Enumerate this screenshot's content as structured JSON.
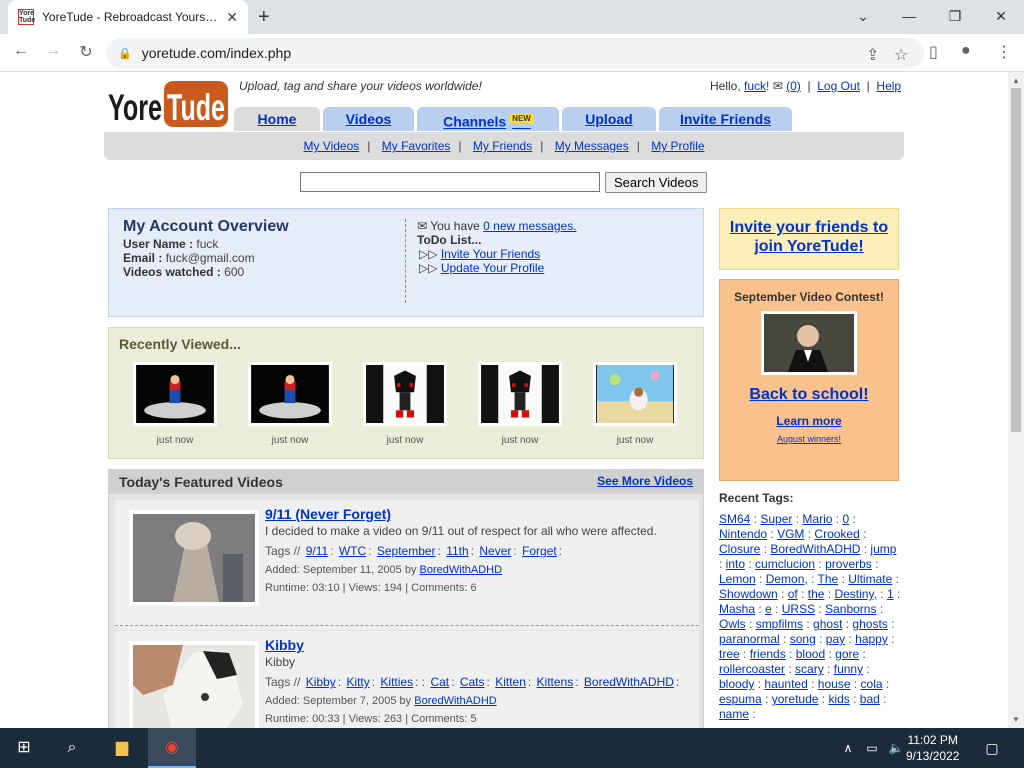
{
  "browser": {
    "tab_title": "YoreTude - Rebroadcast Yourself.",
    "favicon_text": "Yore Tude",
    "url": "yoretude.com/index.php"
  },
  "site": {
    "logo_text_1": "Yore",
    "logo_text_2": "Tude",
    "tagline": "Upload, tag and share your videos worldwide!",
    "hello": "Hello,",
    "username_link": "fuck",
    "messages_count": "(0)",
    "logout": "Log Out",
    "help": "Help"
  },
  "nav": {
    "tabs": [
      {
        "label": "Home"
      },
      {
        "label": "Videos"
      },
      {
        "label": "Channels",
        "badge": "NEW"
      },
      {
        "label": "Upload"
      },
      {
        "label": "Invite Friends"
      }
    ],
    "sub": [
      "My Videos",
      "My Favorites",
      "My Friends",
      "My Messages",
      "My Profile"
    ],
    "separator": "|"
  },
  "search": {
    "button": "Search Videos",
    "value": ""
  },
  "account": {
    "title": "My Account Overview",
    "username_label": "User Name :",
    "username": "fuck",
    "email_label": "Email :",
    "email": "fuck@gmail.com",
    "watched_label": "Videos watched :",
    "watched": "600",
    "you_have": "You have",
    "new_messages": "0 new messages.",
    "todo_label": "ToDo List...",
    "todo": [
      "Invite Your Friends",
      "Update Your Profile"
    ]
  },
  "recent": {
    "title": "Recently Viewed...",
    "items": [
      {
        "when": "just now"
      },
      {
        "when": "just now"
      },
      {
        "when": "just now"
      },
      {
        "when": "just now"
      },
      {
        "when": "just now"
      }
    ]
  },
  "featured": {
    "title": "Today's Featured Videos",
    "see_more": "See More Videos",
    "videos": [
      {
        "title": "9/11 (Never Forget)",
        "desc": "I decided to make a video on 9/11 out of respect for all who were affected.",
        "tags_label": "Tags //",
        "tags": [
          "9/11",
          "WTC",
          "September",
          "11th",
          "Never",
          "Forget"
        ],
        "added": "Added: September 11, 2005 by",
        "author": "BoredWithADHD",
        "stats": "Runtime: 03:10 | Views: 194 | Comments: 6"
      },
      {
        "title": "Kibby",
        "desc": "Kibby",
        "tags_label": "Tags //",
        "tags": [
          "Kibby",
          "Kitty",
          "Kitties",
          ":",
          "Cat",
          "Cats",
          "Kitten",
          "Kittens",
          "BoredWithADHD"
        ],
        "added": "Added: September 7, 2005 by",
        "author": "BoredWithADHD",
        "stats": "Runtime: 00:33 | Views: 263 | Comments: 5"
      }
    ]
  },
  "sidebar": {
    "invite": "Invite your friends to join YoreTude!",
    "contest_title": "September Video Contest!",
    "contest_headline": "Back to school!",
    "learn_more": "Learn more",
    "winners": "August winners!",
    "recent_tags_title": "Recent Tags:",
    "tags": [
      "SM64",
      "Super",
      "Mario",
      "0",
      "Nintendo",
      "VGM",
      "Crooked",
      "Closure",
      "BoredWithADHD",
      "jump",
      "into",
      "cumclucion",
      "proverbs",
      "Lemon",
      "Demon,",
      "The",
      "Ultimate",
      "Showdown",
      "of",
      "the",
      "Destiny,",
      "1",
      "Masha",
      "e",
      "URSS",
      "Sanborns",
      "Owls",
      "smpfilms",
      "ghost",
      "ghosts",
      "paranormal",
      "song",
      "pay",
      "happy",
      "tree",
      "friends",
      "blood",
      "gore",
      "rollercoaster",
      "scary",
      "funny",
      "bloody",
      "haunted",
      "house",
      "cola",
      "espuma",
      "yoretude",
      "kids",
      "bad",
      "name"
    ]
  },
  "taskbar": {
    "time": "11:02 PM",
    "date": "9/13/2022"
  },
  "colors": {
    "link": "#0033cc",
    "tab_blue": "#b9cff0",
    "account_bg": "#e6ecf8",
    "contest_bg": "#f9c28c",
    "invite_bg": "#fbeeb8"
  }
}
